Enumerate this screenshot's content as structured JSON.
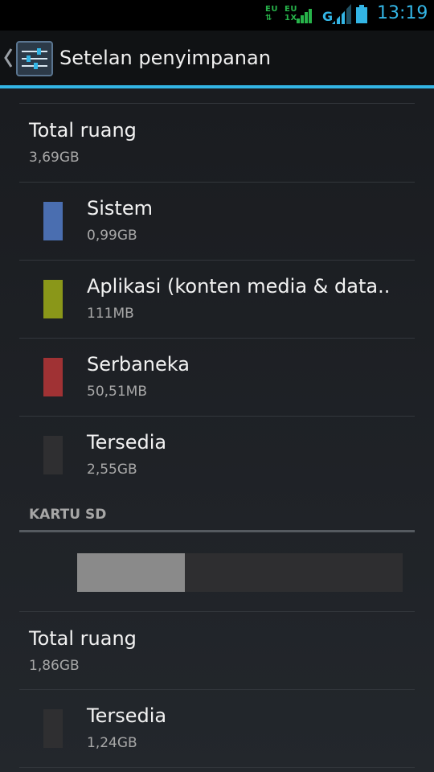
{
  "status_bar": {
    "sim1_label": "EU",
    "sim1_sub": "⇅",
    "sim2_label": "EU",
    "sim2_sub": "1X",
    "network_type": "G",
    "time": "13:19",
    "accent_color": "#33b5e5",
    "sim_color": "#27b34a"
  },
  "action_bar": {
    "title": "Setelan penyimpanan",
    "icon": "settings-sliders-icon"
  },
  "internal_storage": {
    "total_label": "Total ruang",
    "total_value": "3,69GB",
    "categories": [
      {
        "label": "Sistem",
        "value": "0,99GB",
        "color": "#4a6eb0"
      },
      {
        "label": "Aplikasi (konten media & data..",
        "value": "111MB",
        "color": "#8a9719"
      },
      {
        "label": "Serbaneka",
        "value": "50,51MB",
        "color": "#a03234"
      },
      {
        "label": "Tersedia",
        "value": "2,55GB",
        "color": "#2f2f31"
      }
    ]
  },
  "sd_card": {
    "section_header": "KARTU SD",
    "used_fraction": 0.33,
    "total_label": "Total ruang",
    "total_value": "1,86GB",
    "categories": [
      {
        "label": "Tersedia",
        "value": "1,24GB",
        "color": "#2f2f31"
      }
    ]
  }
}
